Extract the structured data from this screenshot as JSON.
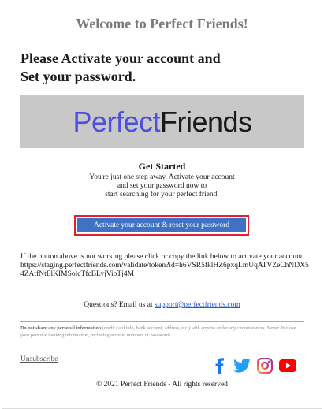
{
  "header": {
    "welcome": "Welcome to Perfect Friends!",
    "headline_line1": "Please Activate your account and",
    "headline_line2": "Set your password."
  },
  "banner": {
    "logo_part1": "Perfect",
    "logo_part2": "Friends",
    "logo_color_primary": "#4d4fe0",
    "logo_color_secondary": "#1a1a1a",
    "background": "#c8c8c8"
  },
  "get_started": {
    "title": "Get Started",
    "line1": "You're just one step away. Activate your account",
    "line2": "and set your password now to",
    "line3": "start searching for your perfect friend."
  },
  "cta": {
    "label": "Activate your account & reset your password",
    "color": "#3f72c4",
    "highlight_color": "#e0202e"
  },
  "fallback": {
    "text": "If the button above is not working please click or copy the link below to activate your account.",
    "link": "https://staging.perfectfriends.com/validate/token?id=h6VSR5fklHZ6pxqLmUqATVZeChNDX54ZAtfNtElKIMSolcTfcBLyjVibTj4M"
  },
  "questions": {
    "text": "Questions? Email us at",
    "email": "support@perfectfriends.com"
  },
  "disclaimer": {
    "bold": "Do not share any personal information",
    "text": "(credit card info, bank account, address, etc.) with anyone under any circumstances. Never disclose your personal banking information, including account numbers or passwords."
  },
  "footer": {
    "unsubscribe": "Unsubscribe",
    "copyright": "© 2021 Perfect Friends - All rights reserved",
    "social": [
      {
        "icon": "facebook-icon",
        "color": "#1877f2"
      },
      {
        "icon": "twitter-icon",
        "color": "#1da1f2"
      },
      {
        "icon": "instagram-icon",
        "color": "#c13584"
      },
      {
        "icon": "youtube-icon",
        "color": "#ff0000"
      }
    ]
  }
}
